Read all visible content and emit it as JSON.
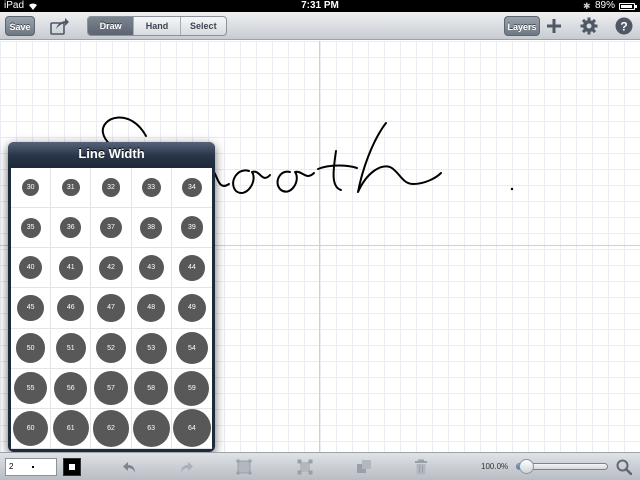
{
  "status_bar": {
    "device": "iPad",
    "time": "7:31 PM",
    "battery_text": "89%",
    "battery_level": 0.89
  },
  "toolbar": {
    "save_label": "Save",
    "modes": [
      {
        "label": "Draw",
        "active": true
      },
      {
        "label": "Hand",
        "active": false
      },
      {
        "label": "Select",
        "active": false
      }
    ],
    "layers_label": "Layers",
    "icons": [
      "share-icon",
      "plus-icon",
      "gear-icon",
      "help-icon"
    ]
  },
  "line_width_popover": {
    "title": "Line Width",
    "options": [
      30,
      31,
      32,
      33,
      34,
      35,
      36,
      37,
      38,
      39,
      40,
      41,
      42,
      43,
      44,
      45,
      46,
      47,
      48,
      49,
      50,
      51,
      52,
      53,
      54,
      55,
      56,
      57,
      58,
      59,
      60,
      61,
      62,
      63,
      64
    ]
  },
  "bottom_bar": {
    "line_width_value": "2",
    "stroke_color": "#000000",
    "zoom_text": "100.0%",
    "zoom_level": 0.1,
    "icons": [
      "undo-icon",
      "redo-icon",
      "group-icon",
      "ungroup-icon",
      "arrange-icon",
      "trash-icon",
      "search-icon"
    ]
  },
  "colors": {
    "accent": "#3f6fb6",
    "popover": "#1f2a3b",
    "dot": "#585858"
  }
}
